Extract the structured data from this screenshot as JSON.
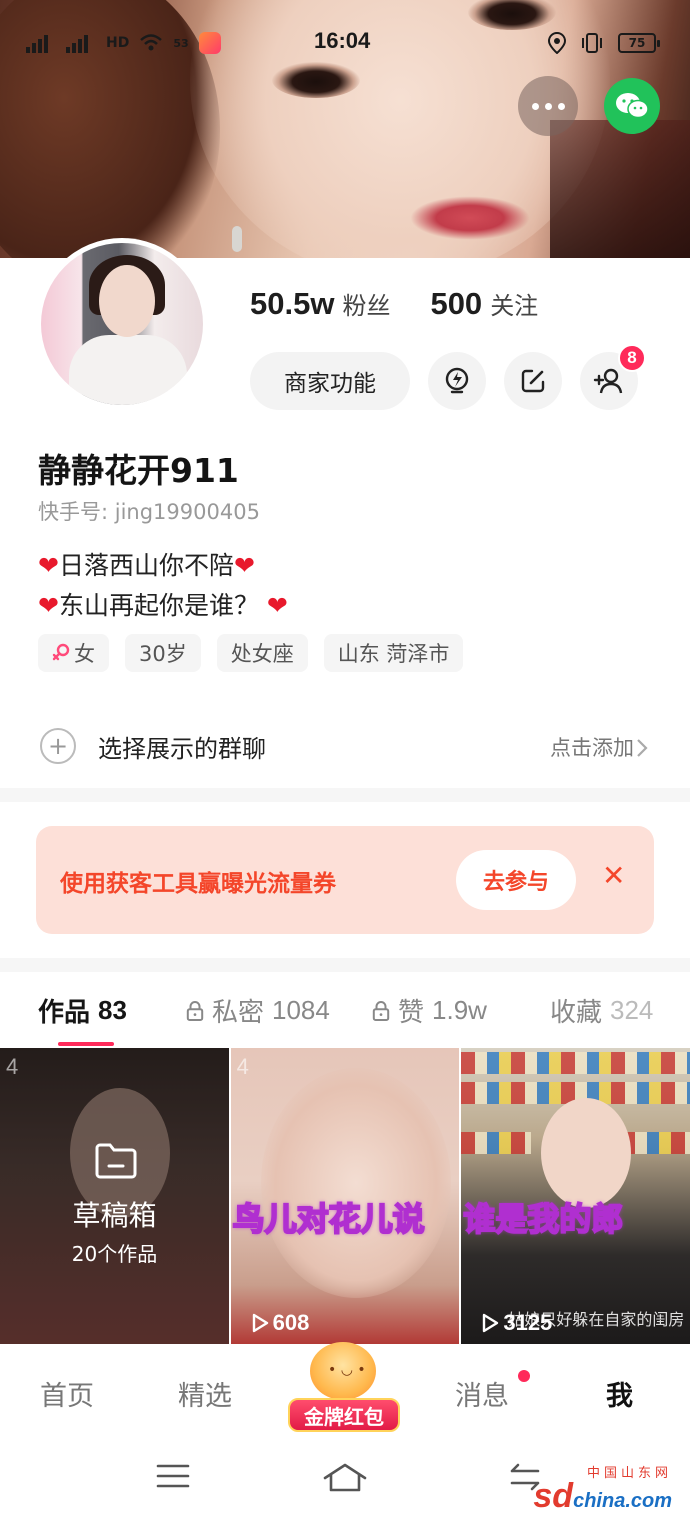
{
  "status_bar": {
    "network_left": "HD",
    "signal_speed": "53",
    "time": "16:04",
    "battery": "75"
  },
  "profile": {
    "followers_count": "50.5w",
    "followers_label": "粉丝",
    "following_count": "500",
    "following_label": "关注",
    "merchant_label": "商家功能",
    "friend_request_badge": "8",
    "nickname": "静静花开911",
    "kwai_id": "快手号: jing19900405",
    "bio_line1": "日落西山你不陪",
    "bio_line2": "东山再起你是谁？",
    "heart": "❤",
    "tags": {
      "gender": "女",
      "age": "30岁",
      "zodiac": "处女座",
      "location": "山东 菏泽市"
    }
  },
  "group_row": {
    "title": "选择展示的群聊",
    "action": "点击添加"
  },
  "promo": {
    "text": "使用获客工具赢曝光流量券",
    "button": "去参与",
    "close": "✕"
  },
  "tabs": {
    "works_label": "作品",
    "works_count": "83",
    "private_label": "私密",
    "private_count": "1084",
    "likes_label": "赞",
    "likes_count": "1.9w",
    "favorites_label": "收藏",
    "favorites_count": "324"
  },
  "grid": {
    "draft_title": "草稿箱",
    "draft_count": "20个作品",
    "cell1_corner": "4",
    "cell2_corner": "4",
    "cell2_overlay": "鸟儿对花儿说",
    "cell2_plays": "608",
    "cell3_overlay": "谁是我的郎",
    "cell3_plays": "3125",
    "cell3_caption": "姑娘只好躲在自家的闺房"
  },
  "bottom_nav": {
    "home": "首页",
    "featured": "精选",
    "redpacket": "金牌红包",
    "messages": "消息",
    "me": "我"
  },
  "watermark": {
    "top": "中国山东网",
    "main": "sd",
    "suffix": "china.com"
  },
  "colors": {
    "accent": "#ff2a5a",
    "promo_text": "#f4462a",
    "promo_bg": "#fde0d8",
    "wechat": "#21c25a"
  }
}
